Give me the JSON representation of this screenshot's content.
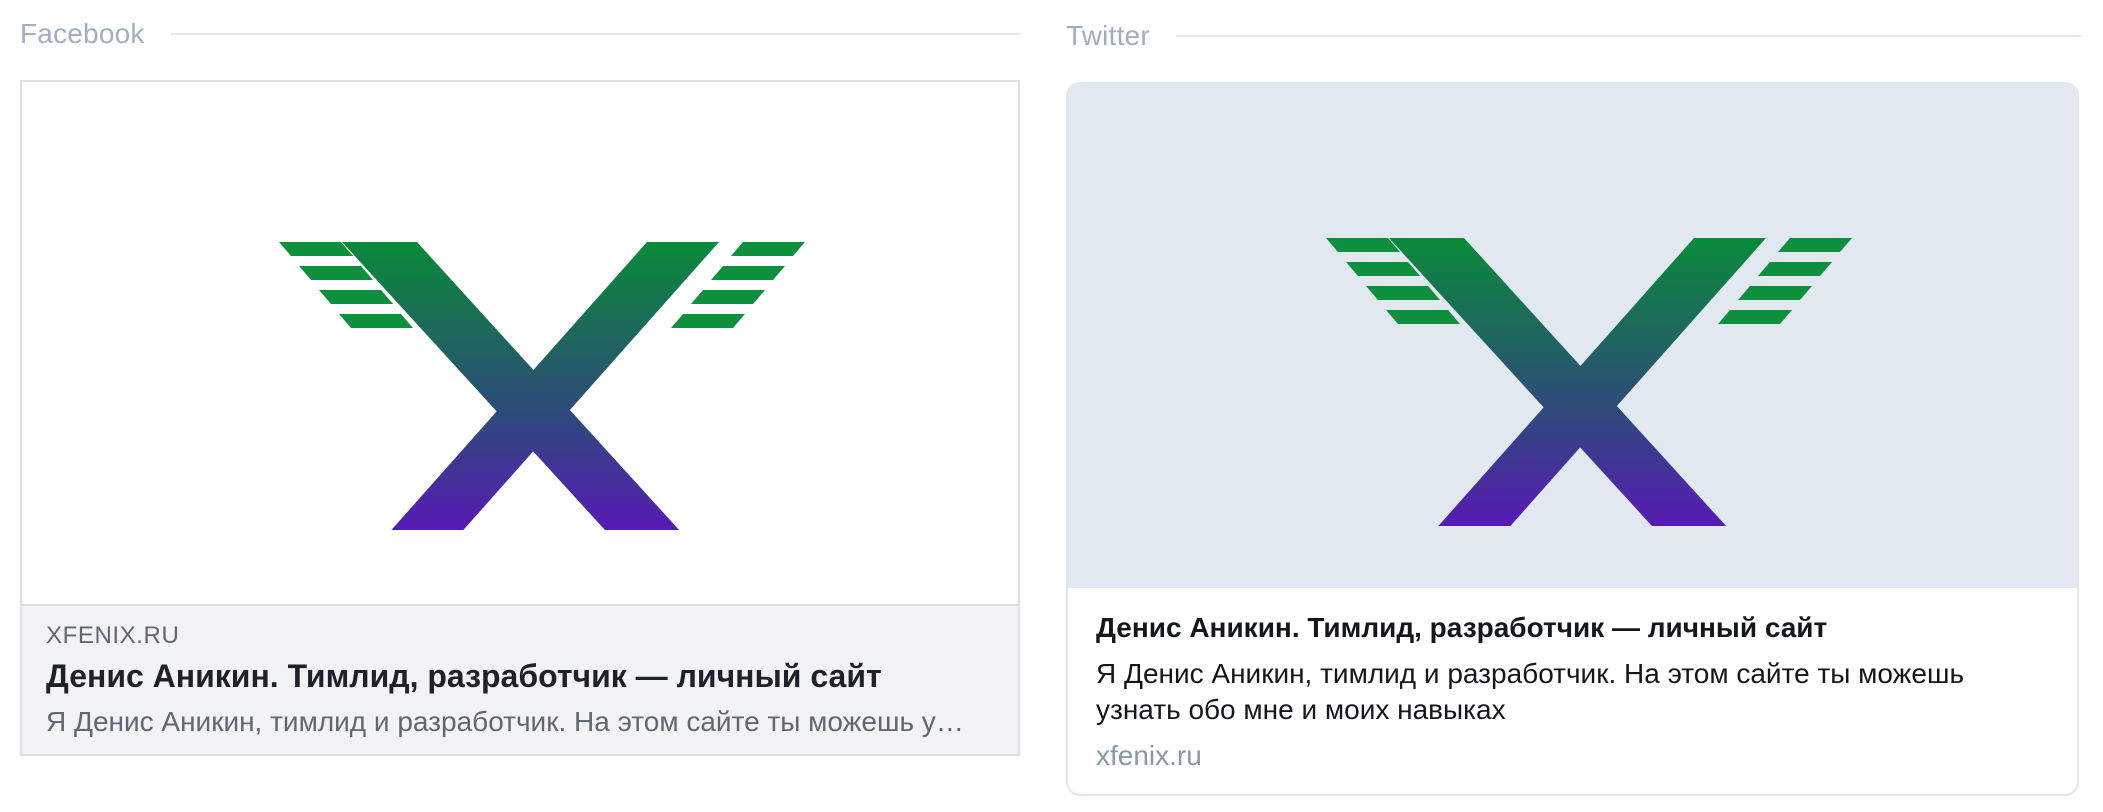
{
  "facebook": {
    "section_label": "Facebook",
    "card": {
      "domain": "XFENIX.RU",
      "title": "Денис Аникин. Тимлид, разработчик — личный сайт",
      "description": "Я Денис Аникин, тимлид и разработчик. На этом сайте ты можешь узнать обо мне и моих навыках"
    }
  },
  "twitter": {
    "section_label": "Twitter",
    "card": {
      "title": "Денис Аникин. Тимлид, разработчик — личный сайт",
      "description": "Я Денис Аникин, тимлид и разработчик. На этом сайте ты можешь узнать обо мне и моих навыках",
      "domain": "xfenix.ru"
    }
  },
  "logo": {
    "name": "xfenix-x-logo",
    "gradient_top": "#0a8a3a",
    "gradient_mid": "#2e4a7a",
    "gradient_bottom": "#7000d6",
    "stripe_color": "#0e8f3e"
  },
  "colors": {
    "twitter_image_bg": "#e2e8f0",
    "facebook_body_bg": "#f2f3f5",
    "heading_color": "#a0aec0"
  }
}
